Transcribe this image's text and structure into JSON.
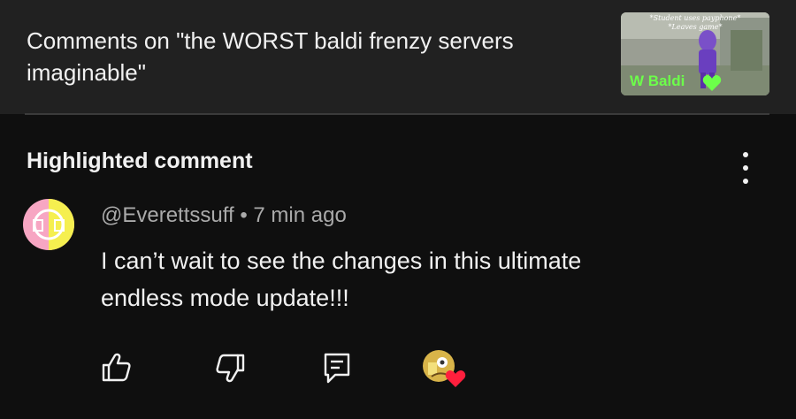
{
  "header": {
    "title": "Comments on \"the WORST baldi frenzy servers imaginable\"",
    "thumbnail": {
      "caption_line1": "*Student uses payphone*",
      "caption_line2": "*Leaves game*",
      "overlay_text": "W Baldi"
    }
  },
  "section": {
    "title": "Highlighted comment",
    "more_icon": "more-vertical-icon"
  },
  "comment": {
    "author": "@Everettssuff",
    "separator": "•",
    "time": "7 min ago",
    "text_line1": "I can’t wait to see the changes in this ultimate",
    "text_line2": "endless mode update!!!"
  },
  "actions": {
    "like_icon": "thumbs-up-icon",
    "dislike_icon": "thumbs-down-icon",
    "reply_icon": "reply-icon",
    "creator_heart_icon": "creator-heart-icon"
  },
  "colors": {
    "background": "#0f0f0f",
    "header_background": "#212121",
    "text_primary": "#f1f1f1",
    "text_secondary": "#aaaaaa",
    "heart": "#ff1f3d",
    "thumbnail_text": "#6cff4a"
  }
}
